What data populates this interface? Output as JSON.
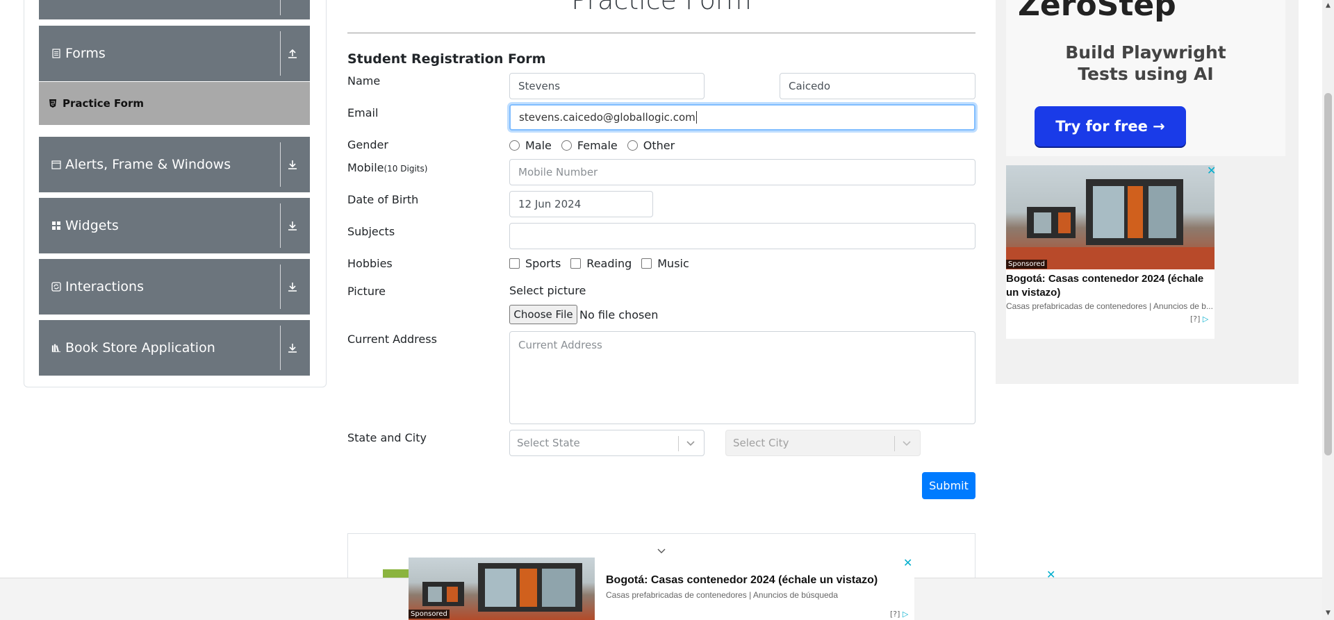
{
  "sidebar": {
    "groups": [
      {
        "label": "Forms",
        "icon": "document-icon",
        "arrow": "upload-icon"
      },
      {
        "label": "Alerts, Frame & Windows",
        "icon": "window-icon",
        "arrow": "download-icon"
      },
      {
        "label": "Widgets",
        "icon": "widgets-icon",
        "arrow": "download-icon"
      },
      {
        "label": "Interactions",
        "icon": "interactions-icon",
        "arrow": "download-icon"
      },
      {
        "label": "Book Store Application",
        "icon": "books-icon",
        "arrow": "download-icon"
      }
    ],
    "active_item": "Practice Form"
  },
  "page": {
    "title": "Practice Form",
    "form_title": "Student Registration Form"
  },
  "form": {
    "name_label": "Name",
    "first_name": "Stevens",
    "last_name": "Caicedo",
    "email_label": "Email",
    "email": "stevens.caicedo@globallogic.com",
    "gender_label": "Gender",
    "gender_options": [
      "Male",
      "Female",
      "Other"
    ],
    "mobile_label": "Mobile",
    "mobile_hint": "(10 Digits)",
    "mobile_placeholder": "Mobile Number",
    "dob_label": "Date of Birth",
    "dob": "12 Jun 2024",
    "subjects_label": "Subjects",
    "hobbies_label": "Hobbies",
    "hobby_options": [
      "Sports",
      "Reading",
      "Music"
    ],
    "picture_label": "Picture",
    "select_picture": "Select picture",
    "choose_file": "Choose File",
    "file_status": "No file chosen",
    "address_label": "Current Address",
    "address_placeholder": "Current Address",
    "state_city_label": "State and City",
    "state_placeholder": "Select State",
    "city_placeholder": "Select City",
    "submit": "Submit"
  },
  "ads": {
    "zerostep": {
      "logo": "ZeroStep",
      "headline_line1": "Build Playwright",
      "headline_line2": "Tests using AI",
      "button": "Try for free →"
    },
    "side_ad": {
      "sponsored": "Sponsored",
      "title": "Bogotá: Casas contenedor 2024 (échale un vistazo)",
      "description": "Casas prefabricadas de contenedores | Anuncios de b...",
      "info": "[?]"
    },
    "bottom_ad": {
      "sponsored": "Sponsored",
      "title": "Bogotá: Casas contenedor 2024 (échale un vistazo)",
      "description": "Casas prefabricadas de contenedores | Anuncios de búsqueda",
      "info": "[?]"
    },
    "close_glyph": "✕"
  },
  "colors": {
    "sidebar_header": "#6c757d",
    "active_item": "#a9a9a9",
    "primary": "#007bff",
    "zerostep_button": "#1a3be8"
  }
}
